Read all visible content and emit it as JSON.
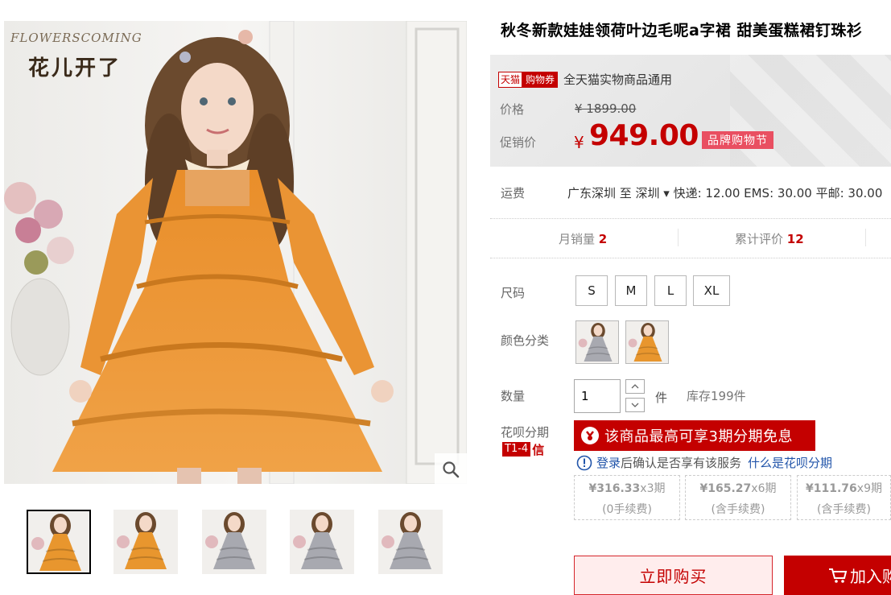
{
  "gallery": {
    "brand_en": "FLOWERSCOMING",
    "brand_cn": "花儿开了",
    "thumbnails": [
      {
        "dress_color": "#e8962e"
      },
      {
        "dress_color": "#e8962e"
      },
      {
        "dress_color": "#a8a9b0"
      },
      {
        "dress_color": "#a8a9b0"
      },
      {
        "dress_color": "#a8a9b0"
      }
    ]
  },
  "product": {
    "title": "秋冬新款娃娃领荷叶边毛呢a字裙 甜美蛋糕裙钉珠衫",
    "coupon": {
      "tmall": "天猫",
      "tag": "购物券",
      "text": "全天猫实物商品通用"
    },
    "price_label": "价格",
    "original_price": "¥ 1899.00",
    "promo_label": "促销价",
    "promo_currency": "¥",
    "promo_price": "949.00",
    "promo_badge": "品牌购物节",
    "shipping_label": "运费",
    "shipping_detail": "广东深圳  至 深圳 ▾ 快递: 12.00 EMS: 30.00 平邮: 30.00",
    "monthly_sales_label": "月销量",
    "monthly_sales": "2",
    "reviews_label": "累计评价",
    "reviews": "12",
    "size_label": "尺码",
    "sizes": [
      "S",
      "M",
      "L",
      "XL"
    ],
    "color_label": "颜色分类",
    "colors": [
      {
        "swatch": "#a8a9b0"
      },
      {
        "swatch": "#e8962e"
      }
    ],
    "qty_label": "数量",
    "qty": "1",
    "unit": "件",
    "stock": "库存199件",
    "huabei_label": "花呗分期",
    "huabei_badge": "T1-4",
    "huabei_credit": "信",
    "huabei_banner": "该商品最高可享3期分期免息",
    "login_link": "登录",
    "login_text": "后确认是否享有该服务",
    "huabei_link": "什么是花呗分期",
    "plans": [
      {
        "amount": "¥316.33",
        "term": "x3期",
        "fee": "(0手续费)"
      },
      {
        "amount": "¥165.27",
        "term": "x6期",
        "fee": "(含手续费)"
      },
      {
        "amount": "¥111.76",
        "term": "x9期",
        "fee": "(含手续费)"
      }
    ],
    "buy_now": "立即购买",
    "add_cart": "加入购物车"
  },
  "colors": {
    "accent": "#c40000",
    "badge": "#e94f61"
  }
}
